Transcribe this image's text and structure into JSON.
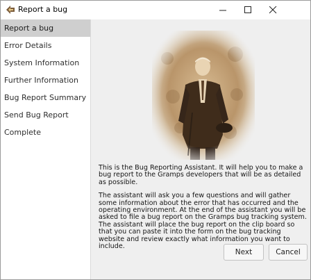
{
  "window": {
    "title": "Report a bug",
    "icon": "gramps-app-icon",
    "controls": [
      "minimize",
      "maximize",
      "close"
    ]
  },
  "sidebar": {
    "items": [
      {
        "label": "Report a bug",
        "active": true
      },
      {
        "label": "Error Details",
        "active": false
      },
      {
        "label": "System Information",
        "active": false
      },
      {
        "label": "Further Information",
        "active": false
      },
      {
        "label": "Bug Report Summary",
        "active": false
      },
      {
        "label": "Send Bug Report",
        "active": false
      },
      {
        "label": "Complete",
        "active": false
      }
    ]
  },
  "main": {
    "image": "sepia-portrait-photo",
    "intro": "This is the Bug Reporting Assistant. It will help you to make a bug report to the Gramps developers that will be as detailed as possible.",
    "description": "The assistant will ask you a few questions and will gather some information about the error that has occurred and the operating environment. At the end of the assistant you will be asked to file a bug report on the Gramps bug tracking system. The assistant will place the bug report on the clip board so that you can paste it into the form on the bug tracking website and review exactly what information you want to include."
  },
  "buttons": {
    "next": "Next",
    "cancel": "Cancel"
  },
  "colors": {
    "sidebar_active": "#cfcfcf",
    "content_bg": "#efefef",
    "photo_sepia": "#c9a77c"
  }
}
